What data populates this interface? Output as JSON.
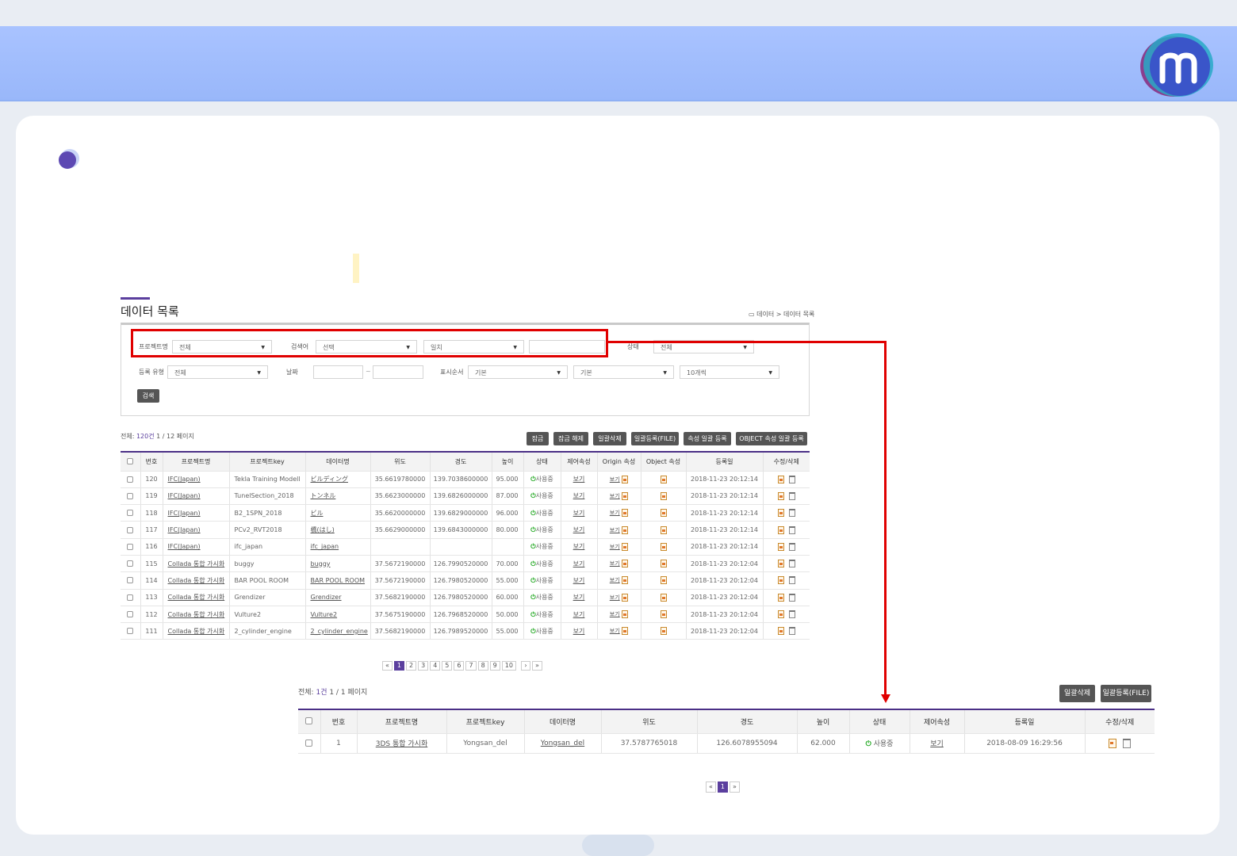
{
  "section": {
    "title": "데이터 목록",
    "breadcrumb": "데이터 > 데이터 목록"
  },
  "search": {
    "project_label": "프로젝트명",
    "project_value": "전체",
    "keyword_label": "검색어",
    "keyword_field": "선택",
    "keyword_match": "일치",
    "keyword_value": "",
    "status_label": "상태",
    "status_value": "전체",
    "regtype_label": "등록 유형",
    "regtype_value": "전체",
    "date_label": "날짜",
    "date_sep": "~",
    "order_label": "표시순서",
    "order_value1": "기본",
    "order_value2": "기본",
    "page_size": "10개씩",
    "button": "검색"
  },
  "list1": {
    "total_prefix": "전체: ",
    "total_count": "120건",
    "total_suffix": " 1 / 12 페이지",
    "buttons": [
      "잠금",
      "잠금 해제",
      "일괄삭제",
      "일괄등록(FILE)",
      "속성 일괄 등록",
      "OBJECT 속성 일괄 등록"
    ],
    "headers": [
      "",
      "번호",
      "프로젝트명",
      "프로젝트key",
      "데이터명",
      "위도",
      "경도",
      "높이",
      "상태",
      "제어속성",
      "Origin 속성",
      "Object 속성",
      "등록일",
      "수정/삭제"
    ],
    "view_label": "보기",
    "rows": [
      {
        "no": "120",
        "project": "IFC(Japan)",
        "key": "Tekla Training Modell",
        "name": "ビルディング",
        "lat": "35.6619780000",
        "lon": "139.7038600000",
        "height": "95.000",
        "status": "사용중",
        "date": "2018-11-23 20:12:14"
      },
      {
        "no": "119",
        "project": "IFC(Japan)",
        "key": "TunelSection_2018",
        "name": "トンネル",
        "lat": "35.6623000000",
        "lon": "139.6826000000",
        "height": "87.000",
        "status": "사용중",
        "date": "2018-11-23 20:12:14"
      },
      {
        "no": "118",
        "project": "IFC(Japan)",
        "key": "B2_1SPN_2018",
        "name": "ビル",
        "lat": "35.6620000000",
        "lon": "139.6829000000",
        "height": "96.000",
        "status": "사용중",
        "date": "2018-11-23 20:12:14"
      },
      {
        "no": "117",
        "project": "IFC(Japan)",
        "key": "PCv2_RVT2018",
        "name": "橋(はし)",
        "lat": "35.6629000000",
        "lon": "139.6843000000",
        "height": "80.000",
        "status": "사용중",
        "date": "2018-11-23 20:12:14"
      },
      {
        "no": "116",
        "project": "IFC(Japan)",
        "key": "ifc_japan",
        "name": "ifc_japan",
        "lat": "",
        "lon": "",
        "height": "",
        "status": "사용중",
        "date": "2018-11-23 20:12:14"
      },
      {
        "no": "115",
        "project": "Collada 통합 가시화",
        "key": "buggy",
        "name": "buggy",
        "lat": "37.5672190000",
        "lon": "126.7990520000",
        "height": "70.000",
        "status": "사용중",
        "date": "2018-11-23 20:12:04"
      },
      {
        "no": "114",
        "project": "Collada 통합 가시화",
        "key": "BAR POOL ROOM",
        "name": "BAR POOL ROOM",
        "lat": "37.5672190000",
        "lon": "126.7980520000",
        "height": "55.000",
        "status": "사용중",
        "date": "2018-11-23 20:12:04"
      },
      {
        "no": "113",
        "project": "Collada 통합 가시화",
        "key": "Grendizer",
        "name": "Grendizer",
        "lat": "37.5682190000",
        "lon": "126.7980520000",
        "height": "60.000",
        "status": "사용중",
        "date": "2018-11-23 20:12:04"
      },
      {
        "no": "112",
        "project": "Collada 통합 가시화",
        "key": "Vulture2",
        "name": "Vulture2",
        "lat": "37.5675190000",
        "lon": "126.7968520000",
        "height": "50.000",
        "status": "사용중",
        "date": "2018-11-23 20:12:04"
      },
      {
        "no": "111",
        "project": "Collada 통합 가시화",
        "key": "2_cylinder_engine",
        "name": "2_cylinder_engine",
        "lat": "37.5682190000",
        "lon": "126.7989520000",
        "height": "55.000",
        "status": "사용중",
        "date": "2018-11-23 20:12:04"
      }
    ],
    "pager": {
      "first": "«",
      "pages": [
        "1",
        "2",
        "3",
        "4",
        "5",
        "6",
        "7",
        "8",
        "9",
        "10"
      ],
      "next": "›",
      "last": "»",
      "current": "1"
    }
  },
  "list2": {
    "total_prefix": "전체: ",
    "total_count": "1건",
    "total_suffix": " 1 / 1 페이지",
    "buttons": [
      "일괄삭제",
      "일괄등록(FILE)"
    ],
    "headers": [
      "",
      "번호",
      "프로젝트명",
      "프로젝트key",
      "데이터명",
      "위도",
      "경도",
      "높이",
      "상태",
      "제어속성",
      "등록일",
      "수정/삭제"
    ],
    "row": {
      "no": "1",
      "project": "3DS 통합 가시화",
      "key": "Yongsan_del",
      "name": "Yongsan_del",
      "lat": "37.5787765018",
      "lon": "126.6078955094",
      "height": "62.000",
      "status": "사용중",
      "view": "보기",
      "date": "2018-08-09 16:29:56"
    },
    "pager": {
      "first": "«",
      "current": "1",
      "last": "»"
    }
  },
  "colors": {
    "header_bar": "#a9c3ff",
    "accent": "#5b3f9e",
    "highlight": "#e00000",
    "active": "#1aa51a"
  }
}
